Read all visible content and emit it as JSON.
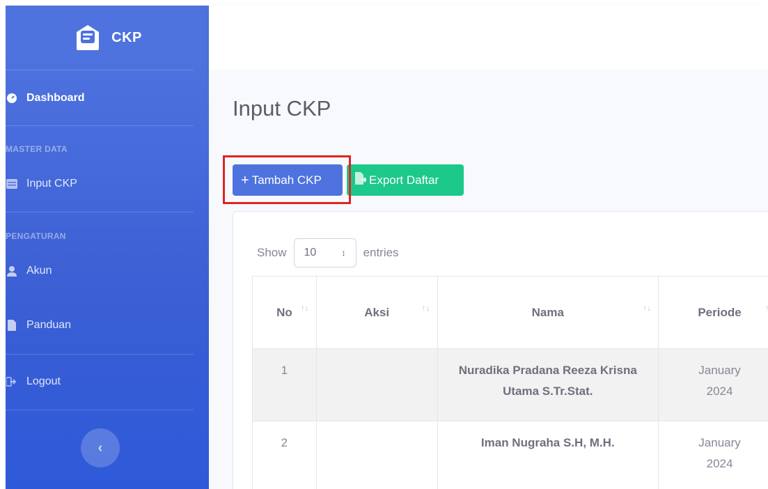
{
  "brand": {
    "name": "CKP"
  },
  "sidebar": {
    "dashboard": "Dashboard",
    "master_heading": "MASTER DATA",
    "input_ckp": "Input CKP",
    "settings_heading": "PENGATURAN",
    "akun": "Akun",
    "panduan": "Panduan",
    "logout": "Logout",
    "toggle": "‹"
  },
  "main": {
    "title": "Input CKP",
    "add_button": "Tambah CKP",
    "export_button": "Export Daftar",
    "show_label": "Show",
    "entries_value": "10",
    "entries_label": "entries"
  },
  "table": {
    "headers": [
      "No",
      "Aksi",
      "Nama",
      "Periode"
    ],
    "rows": [
      {
        "no": "1",
        "aksi": "",
        "nama": "Nuradika Pradana Reeza Krisna Utama S.Tr.Stat.",
        "periode": "January 2024"
      },
      {
        "no": "2",
        "aksi": "",
        "nama": "Iman Nugraha S.H, M.H.",
        "periode": "January 2024"
      }
    ]
  },
  "colors": {
    "primary": "#4e73df",
    "success": "#1cc88a",
    "highlight": "#e02424"
  }
}
